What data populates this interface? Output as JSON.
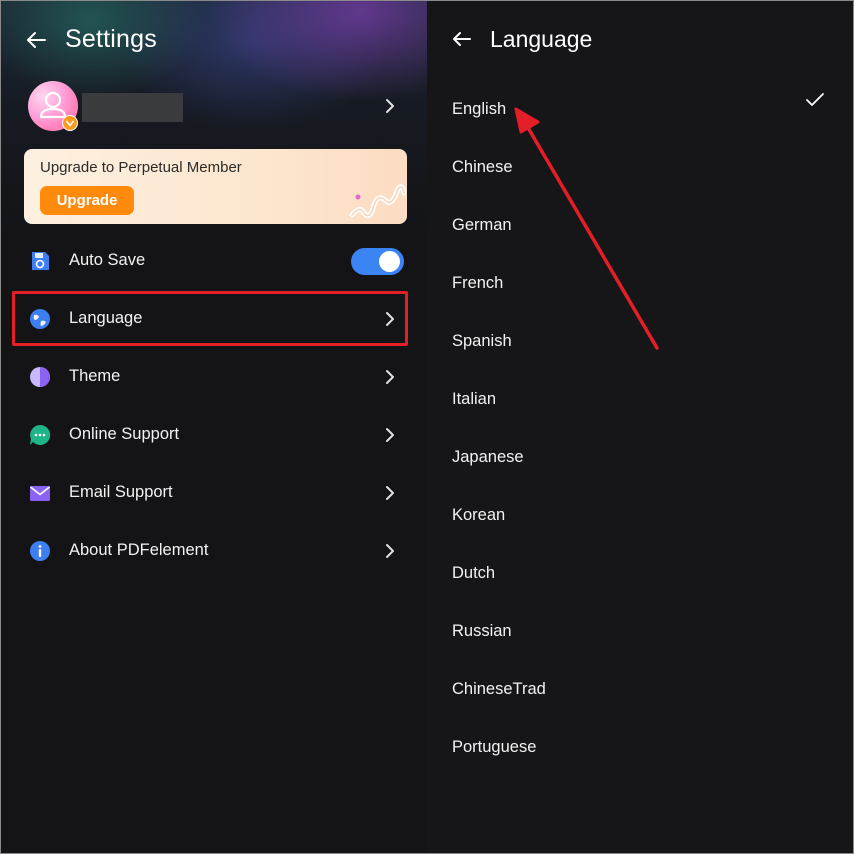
{
  "settings": {
    "title": "Settings",
    "upgrade_card": {
      "text": "Upgrade to Perpetual Member",
      "button_label": "Upgrade"
    },
    "items": [
      {
        "label": "Auto Save",
        "icon": "save-icon"
      },
      {
        "label": "Language",
        "icon": "globe-icon"
      },
      {
        "label": "Theme",
        "icon": "theme-icon"
      },
      {
        "label": "Online Support",
        "icon": "chat-icon"
      },
      {
        "label": "Email Support",
        "icon": "mail-icon"
      },
      {
        "label": "About PDFelement",
        "icon": "info-icon"
      }
    ],
    "auto_save_enabled": true
  },
  "language": {
    "title": "Language",
    "selected": "English",
    "options": [
      "English",
      "Chinese",
      "German",
      "French",
      "Spanish",
      "Italian",
      "Japanese",
      "Korean",
      "Dutch",
      "Russian",
      "ChineseTrad",
      "Portuguese"
    ]
  },
  "colors": {
    "accent_blue": "#3a84f4",
    "upgrade_orange": "#ff8a0c",
    "highlight_red": "#e41e26"
  }
}
